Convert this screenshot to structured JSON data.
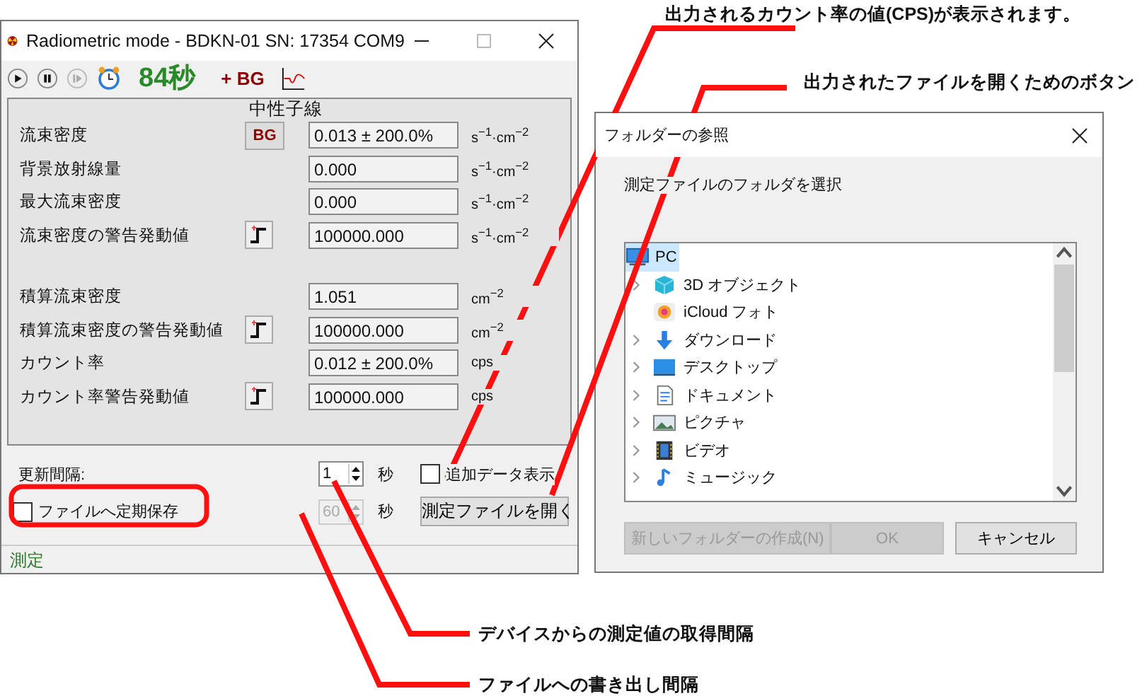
{
  "window": {
    "title": "Radiometric mode - BDKN-01 SN: 17354 COM9"
  },
  "toolbar": {
    "timer": "84秒",
    "bg_label": "+ BG"
  },
  "group": {
    "title": "中性子線",
    "sections": [
      [
        {
          "label": "流束密度",
          "button": "BG",
          "kind": "bg",
          "value": "0.013 ± 200.0%",
          "unit": "s$^{−1}$·cm$^{−2}$"
        },
        {
          "label": "背景放射線量",
          "kind": "none",
          "value": "0.000",
          "unit": "s$^{−1}$·cm$^{−2}$"
        },
        {
          "label": "最大流束密度",
          "kind": "none",
          "value": "0.000",
          "unit": "s$^{−1}$·cm$^{−2}$"
        },
        {
          "label": "流束密度の警告発動値",
          "kind": "alarm",
          "value": "100000.000",
          "unit": "s$^{−1}$·cm$^{−2}$"
        }
      ],
      [
        {
          "label": "積算流束密度",
          "kind": "none",
          "value": "1.051",
          "unit": "cm$^{−2}$"
        },
        {
          "label": "積算流束密度の警告発動値",
          "kind": "alarm",
          "value": "100000.000",
          "unit": "cm$^{−2}$"
        },
        {
          "label": "カウント率",
          "kind": "none",
          "value": "0.012 ± 200.0%",
          "unit": "cps"
        },
        {
          "label": "カウント率警告発動値",
          "kind": "alarm",
          "value": "100000.000",
          "unit": "cps"
        }
      ]
    ]
  },
  "update_interval": {
    "label": "更新間隔:",
    "value": "1",
    "unit": "秒",
    "disabled": false
  },
  "additional_data": {
    "label": "追加データ表示",
    "checked": false
  },
  "save_to_file": {
    "label": "ファイルへ定期保存",
    "checked": false
  },
  "save_interval": {
    "value": "60",
    "unit": "秒",
    "disabled": true
  },
  "open_button": "測定ファイルを開く",
  "status_bar": "測定",
  "dialog": {
    "title": "フォルダーの参照",
    "prompt": "測定ファイルのフォルダを選択",
    "tree": {
      "label": "PC",
      "kind": "pc",
      "selected": true,
      "expanded": true,
      "children": [
        {
          "label": "3D オブジェクト",
          "kind": "cube",
          "expandable": true,
          "selected": false
        },
        {
          "label": "iCloud フォト",
          "kind": "flower",
          "expandable": false,
          "selected": false
        },
        {
          "label": "ダウンロード",
          "kind": "download",
          "expandable": true,
          "selected": false
        },
        {
          "label": "デスクトップ",
          "kind": "desktop",
          "expandable": true,
          "selected": false
        },
        {
          "label": "ドキュメント",
          "kind": "document",
          "expandable": true,
          "selected": false
        },
        {
          "label": "ピクチャ",
          "kind": "picture",
          "expandable": true,
          "selected": false
        },
        {
          "label": "ビデオ",
          "kind": "video",
          "expandable": true,
          "selected": false
        },
        {
          "label": "ミュージック",
          "kind": "music",
          "expandable": true,
          "selected": false
        }
      ]
    },
    "buttons": [
      {
        "label": "新しいフォルダーの作成(N)",
        "disabled": true
      },
      {
        "label": "OK",
        "disabled": true
      },
      {
        "label": "キャンセル",
        "disabled": false
      }
    ]
  },
  "annotations": [
    {
      "text": "出力されるカウント率の値(CPS)が表示されます。"
    },
    {
      "text": "出力されたファイルを開くためのボタン"
    },
    {
      "text": "デバイスからの測定値の取得間隔"
    },
    {
      "text": "ファイルへの書き出し間隔"
    }
  ]
}
